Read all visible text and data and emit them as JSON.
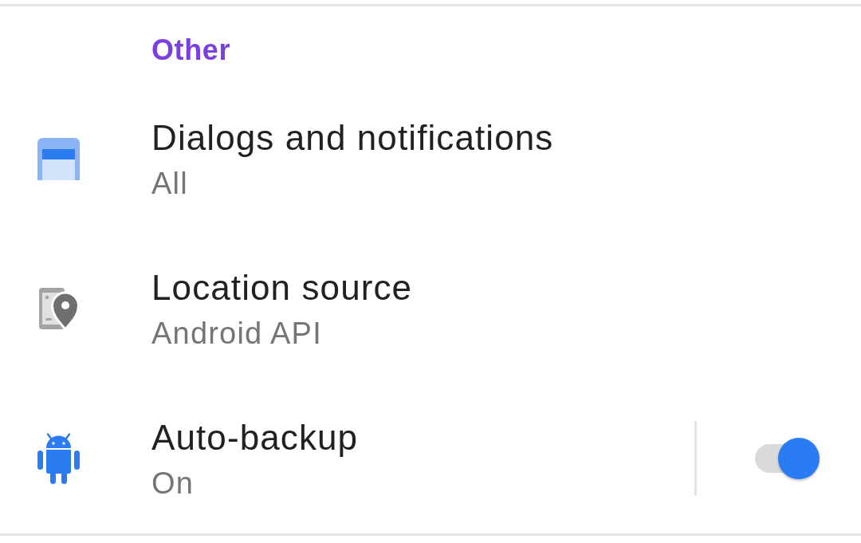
{
  "section": {
    "title": "Other"
  },
  "items": [
    {
      "kind": "nav",
      "title": "Dialogs and notifications",
      "summary": "All"
    },
    {
      "kind": "nav",
      "title": "Location source",
      "summary": "Android API"
    },
    {
      "kind": "toggle",
      "title": "Auto-backup",
      "summary": "On",
      "on": true
    }
  ]
}
